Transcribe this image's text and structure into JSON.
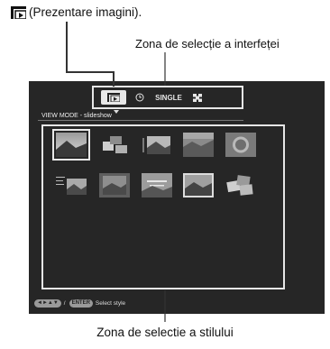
{
  "captions": {
    "top_instruction": "(Prezentare imagini).",
    "interface_zone": "Zona de selecție a interfeței",
    "style_zone": "Zona de selectie a stilului"
  },
  "icons": {
    "slideshow_glyph": "slideshow-icon",
    "mode_slideshow": "slideshow-mode-icon",
    "mode_clock": "clock-icon",
    "mode_index": "index-grid-icon"
  },
  "screen": {
    "mode_bar": {
      "single_label": "SINGLE"
    },
    "view_mode_label": "VIEW MODE - slideshow",
    "bottom_bar": {
      "arrows_key": "◄►▲▼",
      "separator": "/",
      "enter_key": "ENTER",
      "hint": "Select style"
    }
  },
  "thumbnails": [
    {
      "name": "style-1"
    },
    {
      "name": "style-2"
    },
    {
      "name": "style-3"
    },
    {
      "name": "style-4"
    },
    {
      "name": "style-5"
    },
    {
      "name": "style-6"
    },
    {
      "name": "style-7"
    },
    {
      "name": "style-8"
    },
    {
      "name": "style-9"
    },
    {
      "name": "style-10"
    }
  ],
  "colors": {
    "screen_bg": "#262626",
    "frame": "#e6e6e6"
  }
}
